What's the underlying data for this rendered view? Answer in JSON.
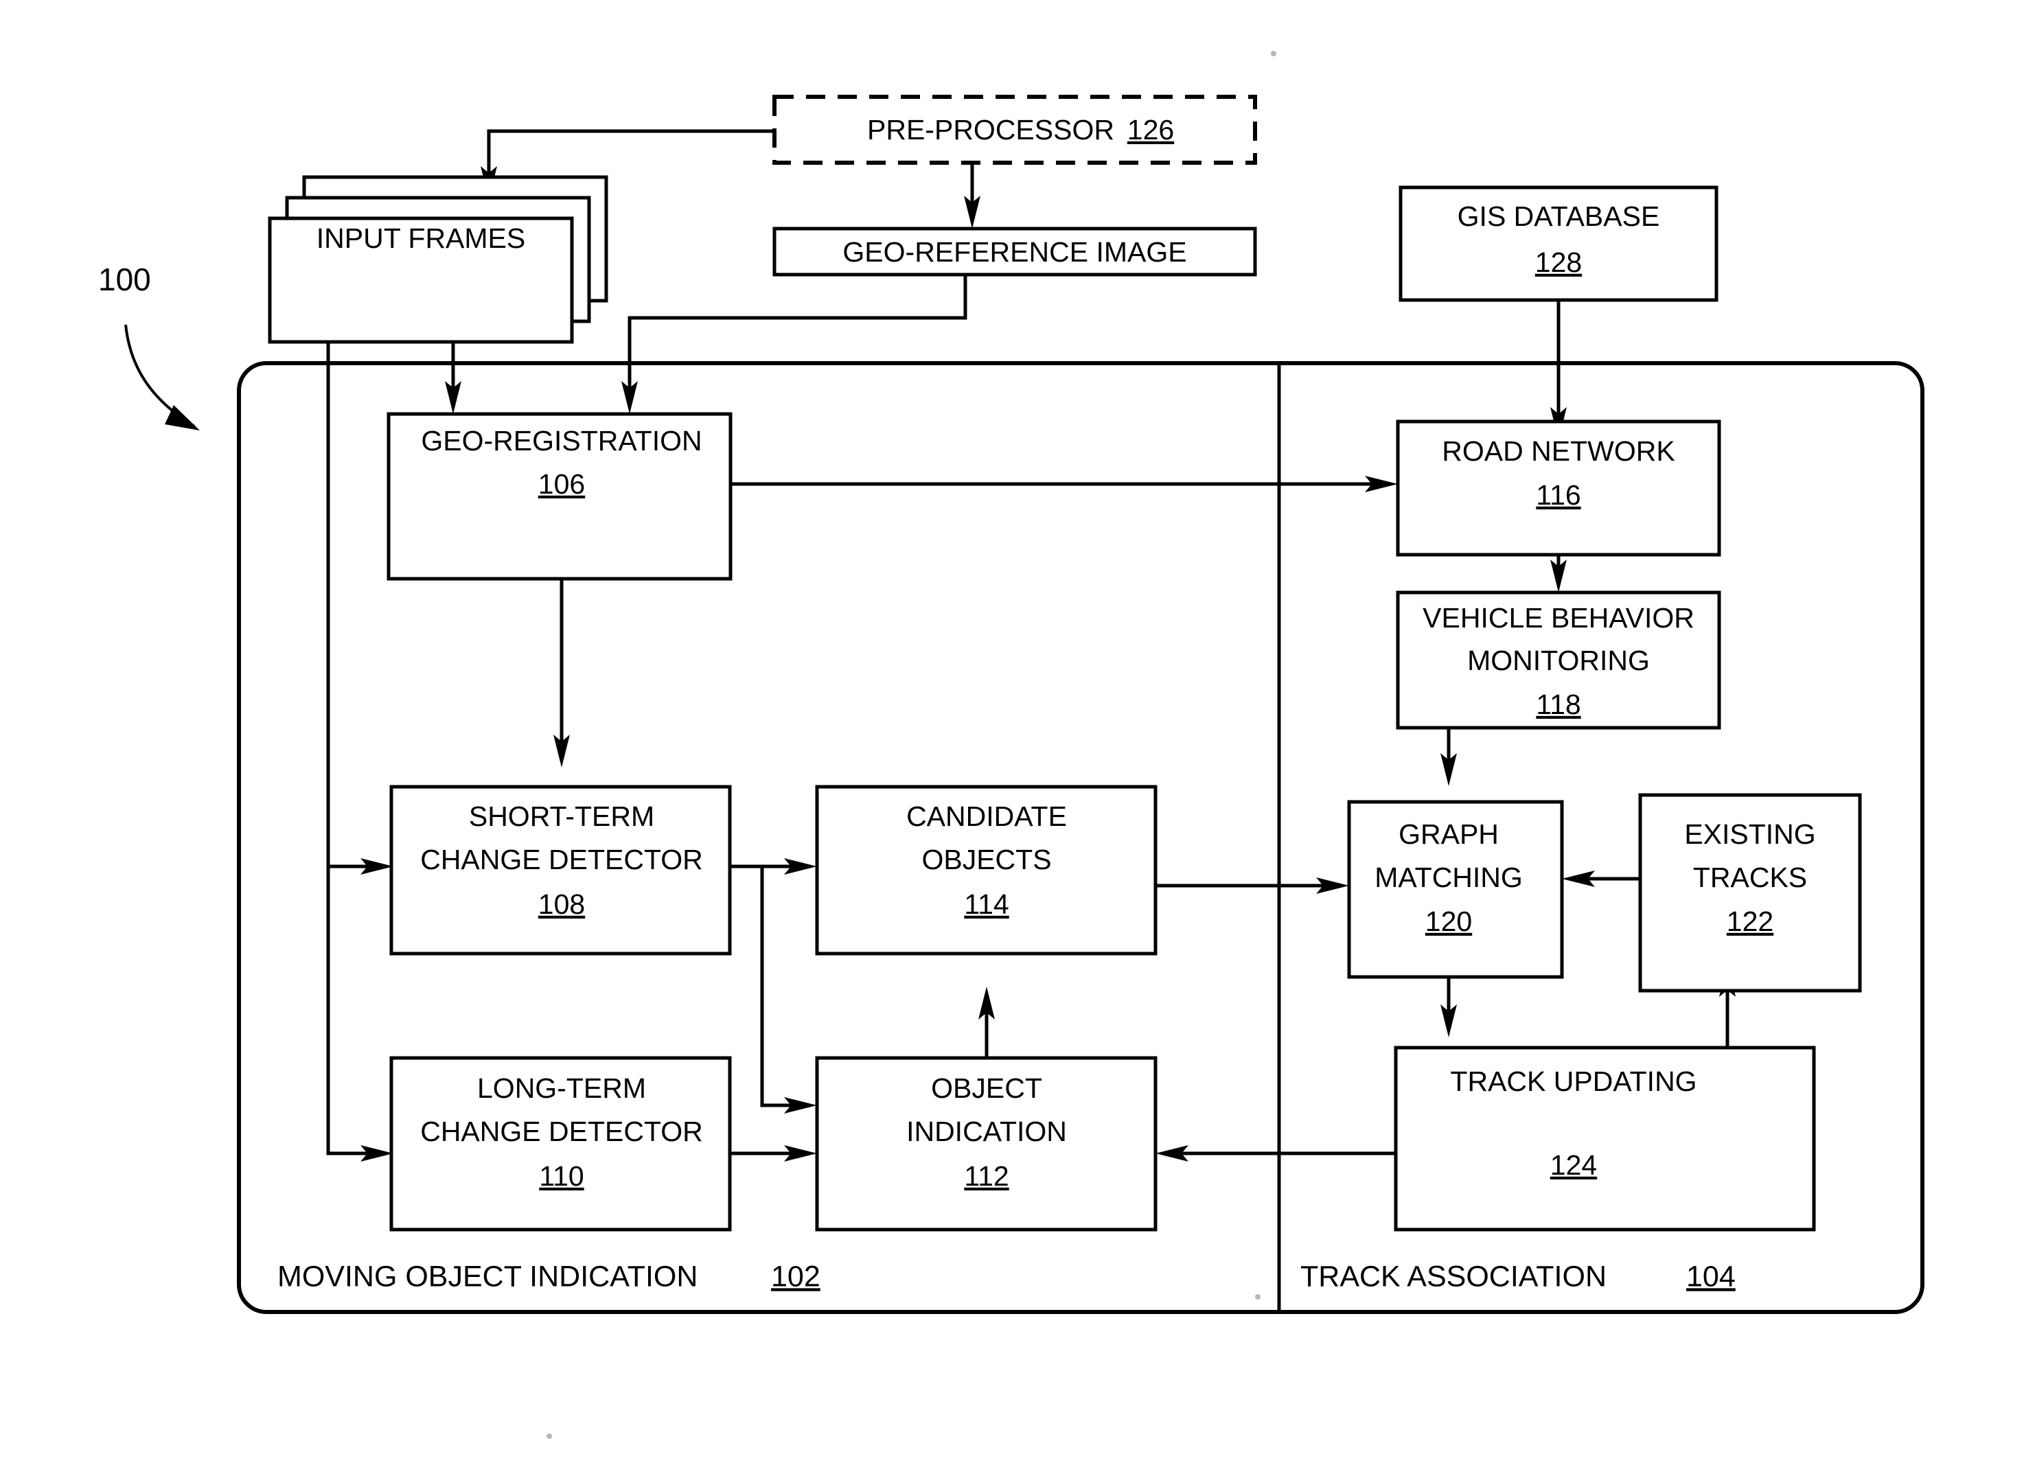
{
  "figure": {
    "reference_numeral": "100"
  },
  "nodes": {
    "pre_processor": {
      "label": "PRE-PROCESSOR",
      "numeral": "126",
      "style": "dashed"
    },
    "input_frames": {
      "label": "INPUT FRAMES",
      "numeral": "",
      "style": "stack"
    },
    "geo_reference_image": {
      "label": "GEO-REFERENCE IMAGE",
      "numeral": "",
      "style": "solid"
    },
    "gis_database": {
      "label": "GIS DATABASE",
      "numeral": "128",
      "style": "solid"
    },
    "geo_registration": {
      "label": "GEO-REGISTRATION",
      "numeral": "106",
      "style": "solid"
    },
    "road_network": {
      "label": "ROAD NETWORK",
      "numeral": "116",
      "style": "solid"
    },
    "vehicle_behavior_monitoring": {
      "label_line1": "VEHICLE BEHAVIOR",
      "label_line2": "MONITORING",
      "numeral": "118",
      "style": "solid"
    },
    "short_term_change_detector": {
      "label_line1": "SHORT-TERM",
      "label_line2": "CHANGE DETECTOR",
      "numeral": "108",
      "style": "solid"
    },
    "candidate_objects": {
      "label_line1": "CANDIDATE",
      "label_line2": "OBJECTS",
      "numeral": "114",
      "style": "solid"
    },
    "graph_matching": {
      "label_line1": "GRAPH",
      "label_line2": "MATCHING",
      "numeral": "120",
      "style": "solid"
    },
    "existing_tracks": {
      "label_line1": "EXISTING",
      "label_line2": "TRACKS",
      "numeral": "122",
      "style": "solid"
    },
    "long_term_change_detector": {
      "label_line1": "LONG-TERM",
      "label_line2": "CHANGE DETECTOR",
      "numeral": "110",
      "style": "solid"
    },
    "object_indication": {
      "label_line1": "OBJECT",
      "label_line2": "INDICATION",
      "numeral": "112",
      "style": "solid"
    },
    "track_updating": {
      "label": "TRACK UPDATING",
      "numeral": "124",
      "style": "solid"
    }
  },
  "sections": {
    "moving_object_indication": {
      "label": "MOVING OBJECT INDICATION",
      "numeral": "102"
    },
    "track_association": {
      "label": "TRACK ASSOCIATION",
      "numeral": "104"
    }
  },
  "colors": {
    "ink": "#000000",
    "paper": "#ffffff"
  }
}
